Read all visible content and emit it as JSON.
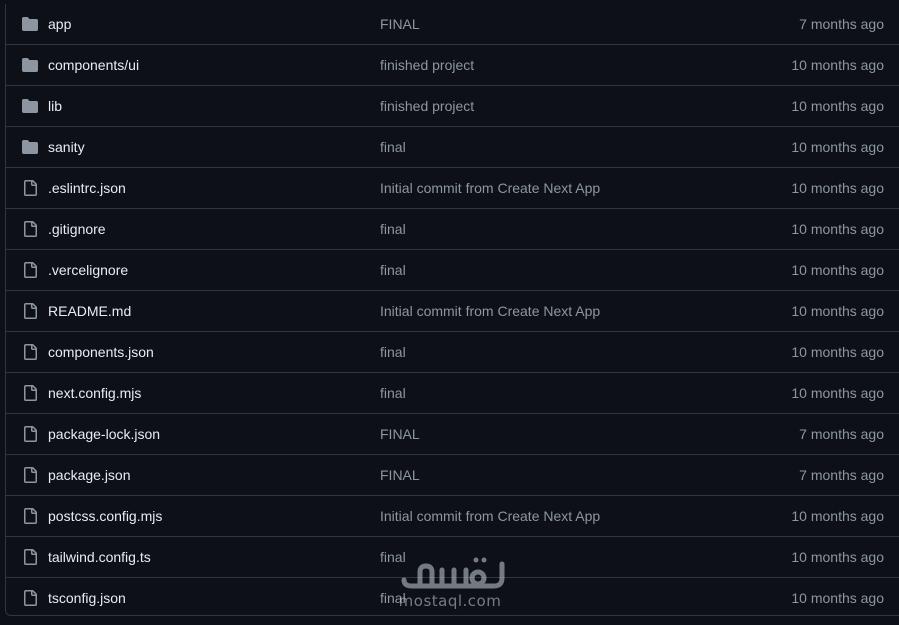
{
  "files": [
    {
      "type": "folder",
      "name": "app",
      "message": "FINAL",
      "date": "7 months ago"
    },
    {
      "type": "folder",
      "name": "components/ui",
      "message": "finished project",
      "date": "10 months ago"
    },
    {
      "type": "folder",
      "name": "lib",
      "message": "finished project",
      "date": "10 months ago"
    },
    {
      "type": "folder",
      "name": "sanity",
      "message": "final",
      "date": "10 months ago"
    },
    {
      "type": "file",
      "name": ".eslintrc.json",
      "message": "Initial commit from Create Next App",
      "date": "10 months ago"
    },
    {
      "type": "file",
      "name": ".gitignore",
      "message": "final",
      "date": "10 months ago"
    },
    {
      "type": "file",
      "name": ".vercelignore",
      "message": "final",
      "date": "10 months ago"
    },
    {
      "type": "file",
      "name": "README.md",
      "message": "Initial commit from Create Next App",
      "date": "10 months ago"
    },
    {
      "type": "file",
      "name": "components.json",
      "message": "final",
      "date": "10 months ago"
    },
    {
      "type": "file",
      "name": "next.config.mjs",
      "message": "final",
      "date": "10 months ago"
    },
    {
      "type": "file",
      "name": "package-lock.json",
      "message": "FINAL",
      "date": "7 months ago"
    },
    {
      "type": "file",
      "name": "package.json",
      "message": "FINAL",
      "date": "7 months ago"
    },
    {
      "type": "file",
      "name": "postcss.config.mjs",
      "message": "Initial commit from Create Next App",
      "date": "10 months ago"
    },
    {
      "type": "file",
      "name": "tailwind.config.ts",
      "message": "final",
      "date": "10 months ago"
    },
    {
      "type": "file",
      "name": "tsconfig.json",
      "message": "final",
      "date": "10 months ago"
    }
  ],
  "icons": {
    "folder": "folder-icon",
    "file": "file-icon"
  },
  "colors": {
    "background": "#0d1117",
    "border": "#30363d",
    "text_primary": "#e6edf3",
    "text_muted": "#8d96a0"
  },
  "watermark": {
    "text": "mostaql.com"
  }
}
